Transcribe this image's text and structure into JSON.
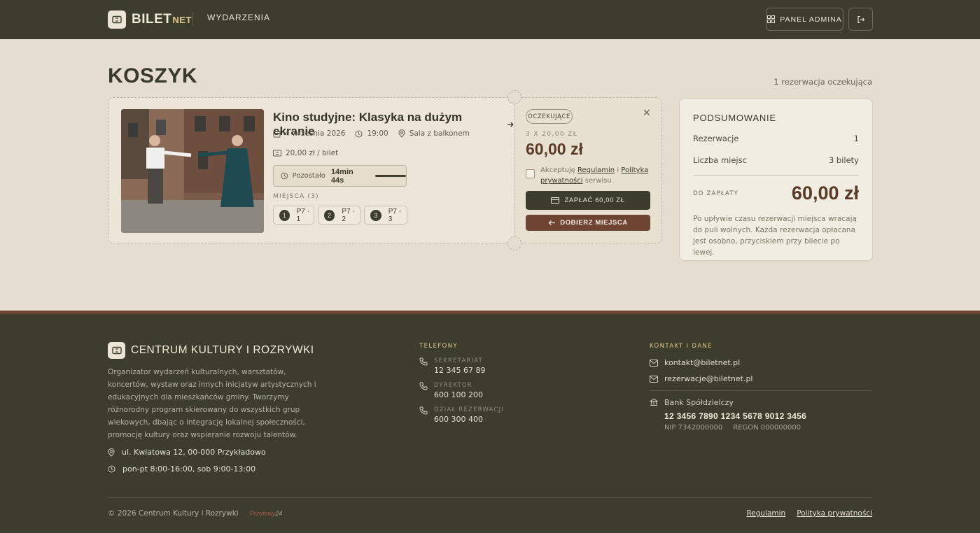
{
  "header": {
    "logo_main": "BILET",
    "logo_suffix": "NET",
    "nav_events": "WYDARZENIA",
    "admin_button": "PANEL ADMINA"
  },
  "page": {
    "title": "KOSZYK",
    "pending_count": "1 rezerwacja oczekująca"
  },
  "reservation": {
    "event_title": "Kino studyjne: Klasyka na dużym ekranie",
    "date": "4 września 2026",
    "time": "19:00",
    "venue": "Sala z balkonem",
    "price": "20,00 zł / bilet",
    "timer_label": "Pozostało",
    "timer_value": "14min 44s",
    "seats_label": "MIEJSCA (3)",
    "seats": [
      {
        "num": "1",
        "label": "P7 · 1"
      },
      {
        "num": "2",
        "label": "P7 · 2"
      },
      {
        "num": "3",
        "label": "P7 · 3"
      }
    ],
    "status_badge": "OCZEKUJĄCE",
    "quantity_line": "3 X 20,00 ZŁ",
    "total": "60,00 zł",
    "accept_prefix": "Akceptuję",
    "accept_terms": "Regulamin",
    "accept_and": "i",
    "accept_privacy": "Polityka prywatności",
    "accept_suffix": "serwisu",
    "pay_button": "ZAPŁAĆ 60,00 ZŁ",
    "more_seats_button": "DOBIERZ MIEJSCA"
  },
  "summary": {
    "title": "PODSUMOWANIE",
    "reservations_label": "Rezerwacje",
    "reservations_value": "1",
    "seats_label": "Liczba miejsc",
    "seats_value": "3 bilety",
    "pay_label": "DO ZAPŁATY",
    "pay_total": "60,00 zł",
    "note": "Po upływie czasu rezerwacji miejsca wracają do puli wolnych. Każda rezerwacja opłacana jest osobno, przyciskiem przy bilecie po lewej."
  },
  "footer": {
    "org_name": "CENTRUM KULTURY I ROZRYWKI",
    "description": "Organizator wydarzeń kulturalnych, warsztatów, koncertów, wystaw oraz innych inicjatyw artystycznych i edukacyjnych dla mieszkańców gminy. Tworzymy różnorodny program skierowany do wszystkich grup wiekowych, dbając o integrację lokalnej społeczności, promocję kultury oraz wspieranie rozwoju talentów.",
    "address": "ul. Kwiatowa 12, 00-000 Przykładowo",
    "hours": "pon-pt 8:00-16:00, sob 9:00-13:00",
    "phones_title": "TELEFONY",
    "phones": [
      {
        "label": "SEKRETARIAT",
        "number": "12 345 67 89"
      },
      {
        "label": "DYREKTOR",
        "number": "600 100 200"
      },
      {
        "label": "DZIAŁ REZERWACJI",
        "number": "600 300 400"
      }
    ],
    "contact_title": "KONTAKT I DANE",
    "email_1": "kontakt@biletnet.pl",
    "email_2": "rezerwacje@biletnet.pl",
    "bank_name": "Bank Spółdzielczy",
    "bank_account": "12 3456 7890 1234 5678 9012 3456",
    "nip": "NIP 7342000000",
    "regon": "REGON 000000000",
    "copyright": "© 2026 Centrum Kultury i Rozrywki",
    "payment_logo_a": "Przelewy",
    "payment_logo_b": "24",
    "link_terms": "Regulamin",
    "link_privacy": "Polityka prywatności"
  },
  "colors": {
    "header_bg": "#3d3d2e",
    "page_bg": "#e5ddd0",
    "accent_brown": "#6e4533",
    "price_brown": "#5a3a26",
    "gold": "#e0c690"
  },
  "icons": {
    "logo": "ticket-icon",
    "admin": "grid-icon",
    "logout": "logout-icon",
    "date": "calendar-icon",
    "time": "clock-icon",
    "venue": "location-pin-icon",
    "price": "ticket-icon",
    "close": "close-icon",
    "pay": "card-icon",
    "back": "arrow-left-icon",
    "phone": "phone-icon",
    "mail": "mail-icon",
    "bank": "bank-icon"
  }
}
